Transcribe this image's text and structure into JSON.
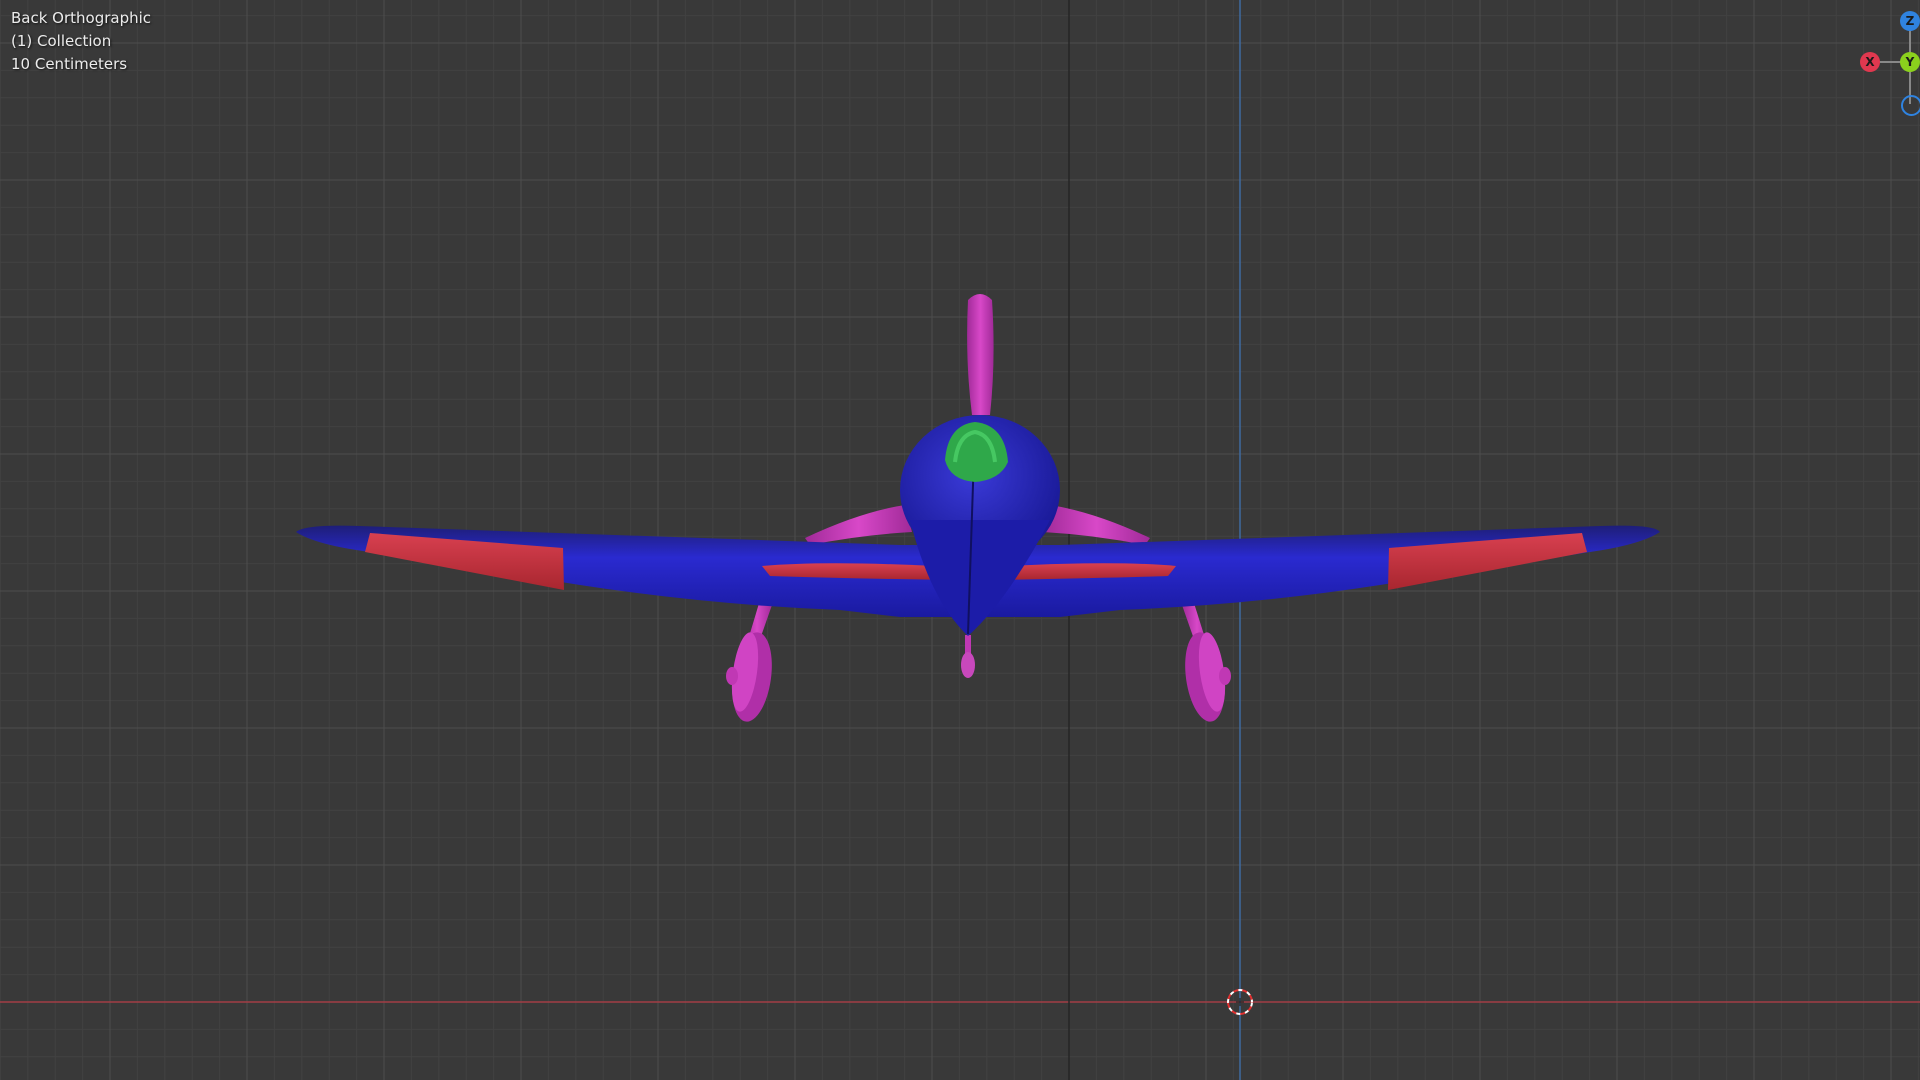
{
  "viewport": {
    "view_name": "Back Orthographic",
    "collection": "(1) Collection",
    "grid_scale": "10 Centimeters",
    "background_color": "#393939"
  },
  "gizmo": {
    "x_label": "X",
    "y_label": "Y",
    "z_label": "Z",
    "x_color": "#e0384f",
    "y_color": "#8bd11d",
    "z_color": "#2f83e0"
  },
  "scene": {
    "object": "airplane model",
    "colors": {
      "body": "#2424c8",
      "propeller": "#c838b8",
      "canopy": "#2fa84a",
      "wing_accent": "#c8323c"
    },
    "cursor_icon": "3d-cursor-icon"
  }
}
